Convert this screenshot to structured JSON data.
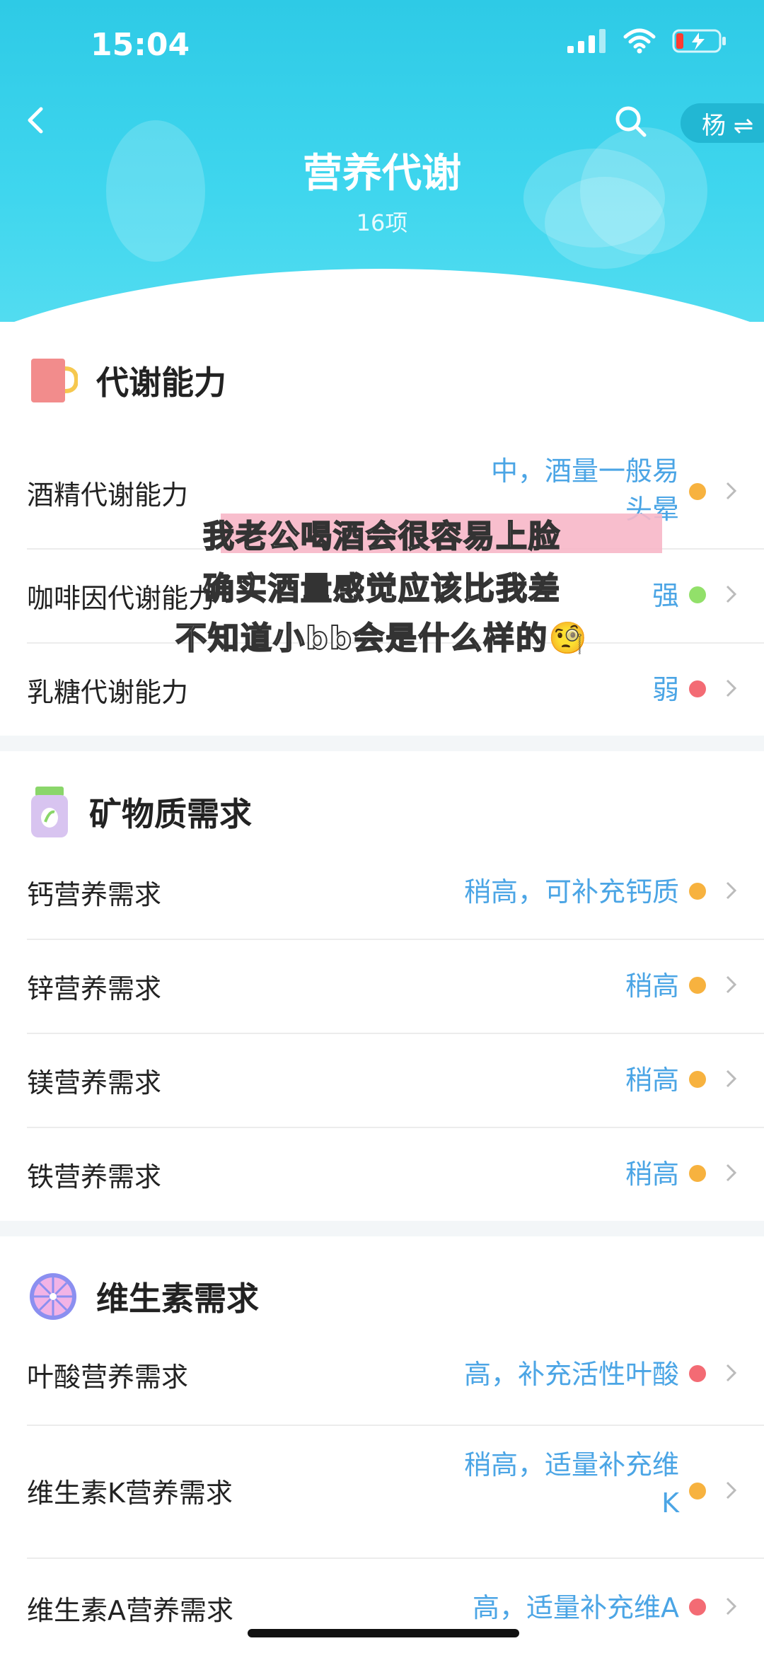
{
  "status": {
    "time": "15:04"
  },
  "header": {
    "title": "营养代谢",
    "count": "16项",
    "user_chip": "杨 ⇌"
  },
  "colors": {
    "accent": "#2ecae6",
    "value_blue": "#4ba5e5",
    "orange": "#f7b23f",
    "green": "#92e06a",
    "red": "#f36b74"
  },
  "sections": {
    "metabolism": {
      "title": "代谢能力",
      "icon": "mug-icon",
      "rows": [
        {
          "label": "酒精代谢能力",
          "value_line1": "中，酒量一般易",
          "value_line2": "头晕",
          "status": "orange"
        },
        {
          "label": "咖啡因代谢能力",
          "value": "强",
          "status": "green"
        },
        {
          "label": "乳糖代谢能力",
          "value": "弱",
          "status": "red"
        }
      ]
    },
    "minerals": {
      "title": "矿物质需求",
      "icon": "supplement-bottle-icon",
      "rows": [
        {
          "label": "钙营养需求",
          "value": "稍高，可补充钙质",
          "status": "orange"
        },
        {
          "label": "锌营养需求",
          "value": "稍高",
          "status": "orange"
        },
        {
          "label": "镁营养需求",
          "value": "稍高",
          "status": "orange"
        },
        {
          "label": "铁营养需求",
          "value": "稍高",
          "status": "orange"
        }
      ]
    },
    "vitamins": {
      "title": "维生素需求",
      "icon": "citrus-slice-icon",
      "rows": [
        {
          "label": "叶酸营养需求",
          "value": "高，补充活性叶酸",
          "status": "red"
        },
        {
          "label": "维生素K营养需求",
          "value_line1": "稍高，适量补充维",
          "value_line2": "K",
          "status": "orange"
        },
        {
          "label": "维生素A营养需求",
          "value": "高，适量补充维A",
          "status": "red"
        }
      ]
    }
  },
  "overlay": {
    "line1": "我老公喝酒会很容易上脸",
    "line2": "确实酒量感觉应该比我差",
    "line3": "不知道小bb会是什么样的🧐"
  }
}
